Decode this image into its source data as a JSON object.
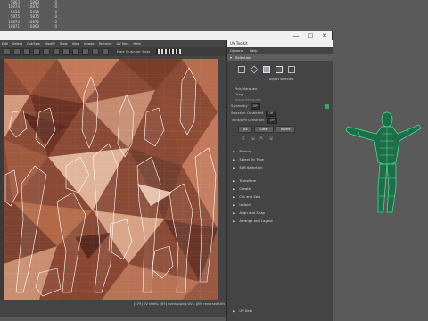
{
  "background_stats": [
    [
      "5863",
      "5863",
      "0"
    ],
    [
      "10874",
      "10872",
      "0"
    ],
    [
      "5415",
      "5415",
      "0"
    ],
    [
      "5875",
      "5875",
      "0"
    ],
    [
      "10874",
      "10872",
      "0"
    ],
    [
      "10871",
      "10860",
      "0"
    ]
  ],
  "uv_editor": {
    "menu": [
      "Edit",
      "Select",
      "Cut/Sew",
      "Modify",
      "Tools",
      "View",
      "Image",
      "Textures",
      "UV Sets",
      "Help"
    ],
    "texture_field": "Male_Muscular_Suits",
    "window_controls": [
      "—",
      "□",
      "✕"
    ],
    "status_text": "[579] UV shells, [89] overlapping UVs, [89] reversed UVs"
  },
  "toolkit": {
    "title": "UV Toolkit",
    "menu": [
      "Options",
      "Help"
    ],
    "selection_title": "Selection",
    "selected_note": "1 object selected",
    "pick_marquee": "Pick/Marquee",
    "drag": "Drag",
    "tweak_marquee": "Tweak/Marquee",
    "symmetry_label": "Symmetry",
    "symmetry_value": "Off",
    "shell_constraint_label": "Selection Constraint",
    "shell_constraint_value": "Off",
    "transform_constraint_label": "Transform Constraint",
    "transform_constraint_value": "Off",
    "buttons": [
      "All",
      "Clear",
      "Invert"
    ],
    "groups": [
      "Pinning",
      "Select By Type",
      "Soft Selection",
      "Transform",
      "Create",
      "Cut and Sew",
      "Unfold",
      "Align and Snap",
      "Arrange and Layout"
    ],
    "bottom_group": "UV Sets"
  },
  "colors": {
    "viewport_base": "#8a4a35",
    "wire": "#ffffff",
    "figure_wire": "#3ddc8f"
  }
}
